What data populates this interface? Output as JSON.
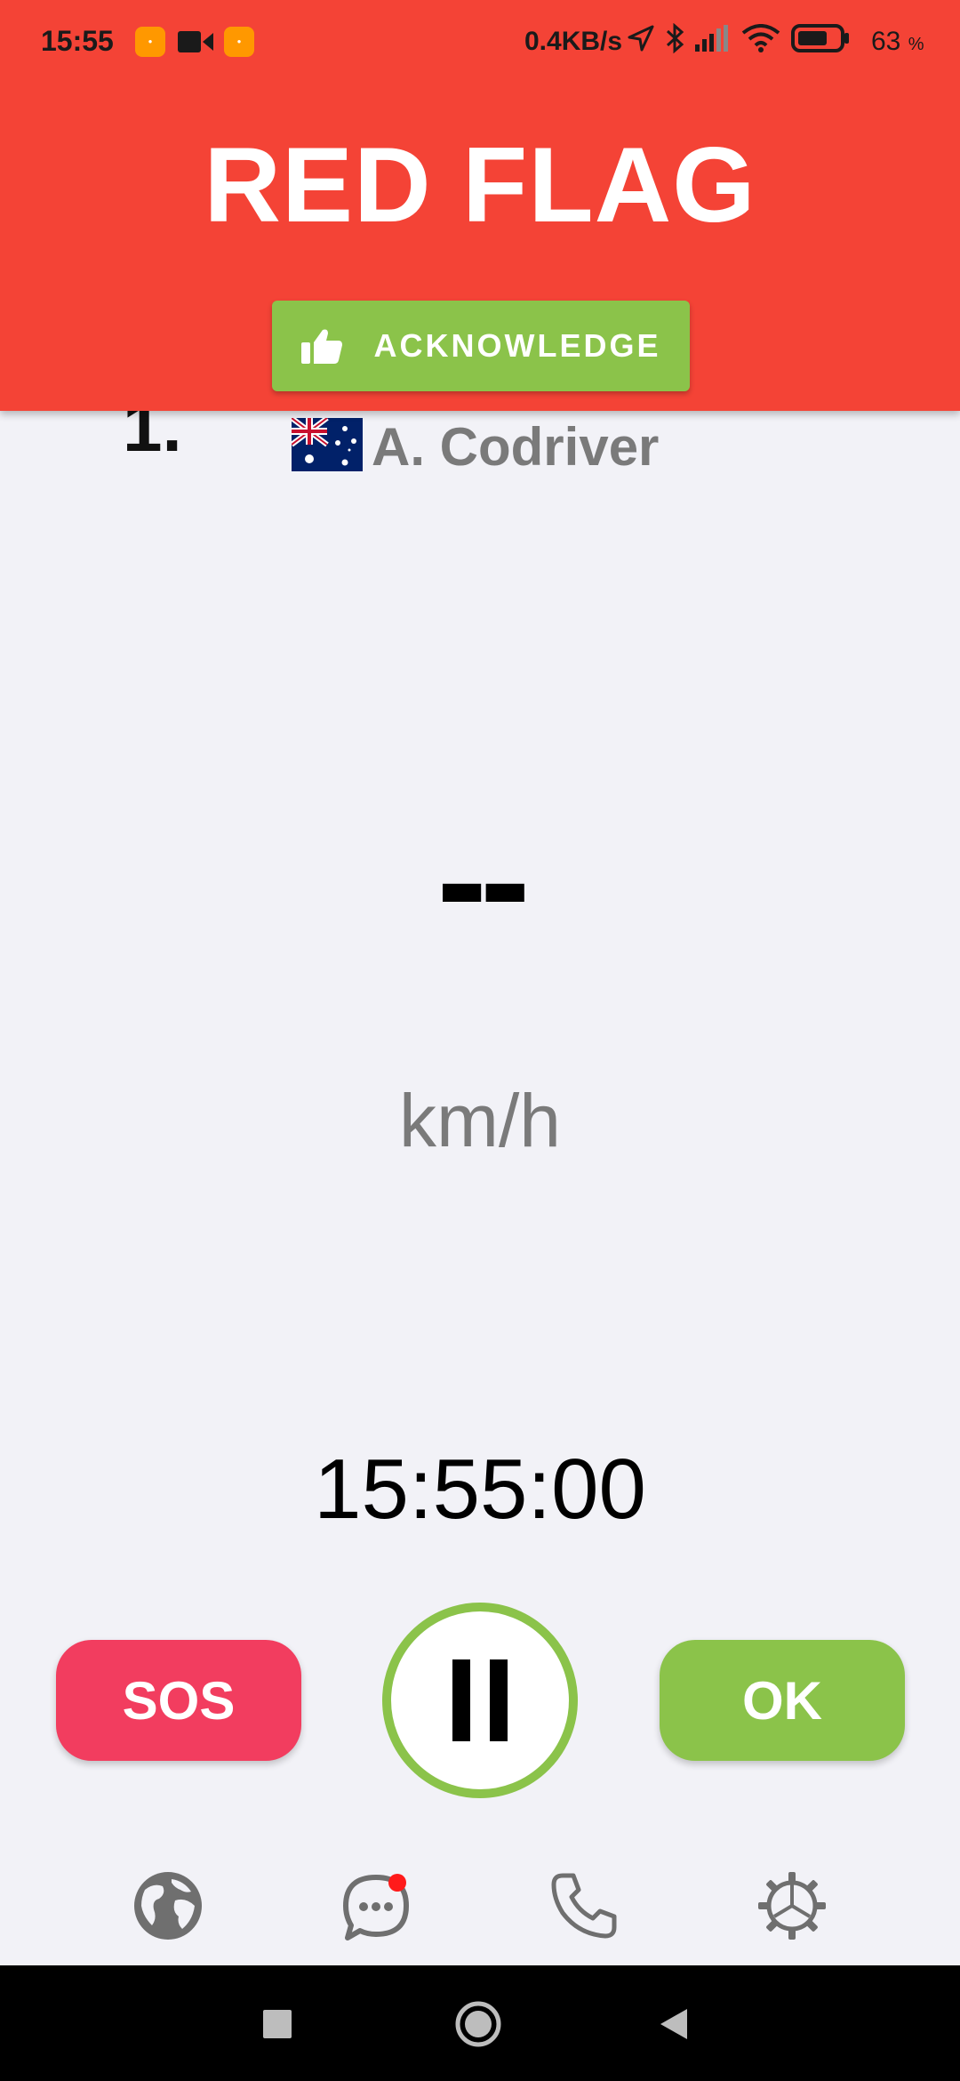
{
  "status_bar": {
    "time": "15:55",
    "network_speed": "0.4KB/s",
    "battery_percent": "63",
    "battery_unit": "%",
    "icons": [
      "app-badge-icon",
      "video-camera-icon",
      "app-badge-icon",
      "location-arrow-icon",
      "bluetooth-icon",
      "signal-icon",
      "wifi-icon",
      "battery-icon"
    ]
  },
  "alert": {
    "title": "RED FLAG",
    "acknowledge_label": "ACKNOWLEDGE",
    "acknowledge_icon": "thumbs-up-icon",
    "color": "#f44336"
  },
  "driver": {
    "position": "1.",
    "flag": "australia-flag-icon",
    "name": "A. Codriver"
  },
  "speed": {
    "value": "--",
    "unit": "km/h"
  },
  "clock": "15:55:00",
  "actions": {
    "sos_label": "SOS",
    "ok_label": "OK",
    "pause_icon": "pause-icon",
    "sos_color": "#f23d5f",
    "ok_color": "#8bc34a"
  },
  "tabs": [
    {
      "icon": "globe-icon"
    },
    {
      "icon": "chat-icon",
      "has_notification": true
    },
    {
      "icon": "phone-icon"
    },
    {
      "icon": "settings-gear-icon"
    }
  ],
  "nav_bar": [
    "recents-square-icon",
    "home-circle-icon",
    "back-triangle-icon"
  ]
}
